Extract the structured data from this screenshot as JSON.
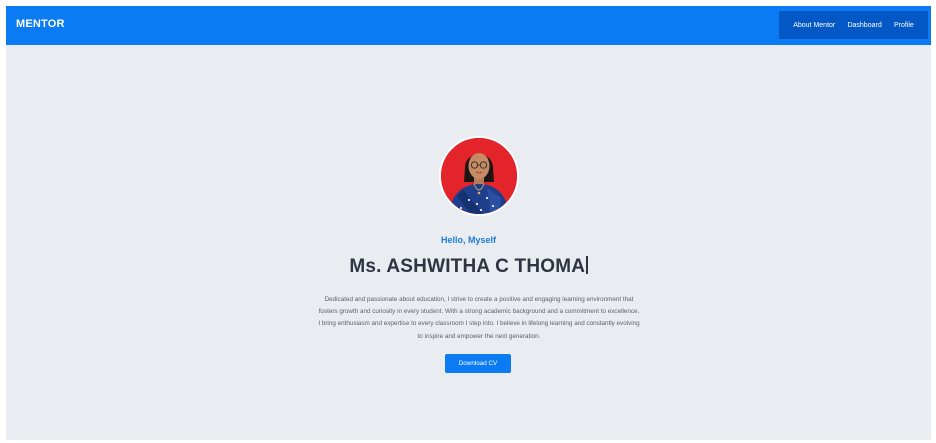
{
  "navbar": {
    "brand": "MENTOR",
    "links": [
      {
        "label": "About Mentor"
      },
      {
        "label": "Dashboard"
      },
      {
        "label": "Profile"
      }
    ]
  },
  "hero": {
    "greeting": "Hello, Myself",
    "name": "Ms. ASHWITHA C THOMA",
    "bio_lines": [
      "Dedicated and passionate about education, I strive to create a positive and engaging learning environment that",
      "fosters growth and curiosity in every student. With a strong academic background and a commitment to excellence,",
      "I bring enthusiasm and expertise to every classroom I step into. I believe in lifelong learning and constantly evolving",
      "to inspire and empower the next generation."
    ],
    "cta_label": "Download CV"
  },
  "colors": {
    "primary": "#0a7bf2",
    "nav_links_bg": "#0458c6",
    "page_bg": "#e9ecf1",
    "avatar_bg": "#e3242a",
    "greeting_text": "#1d7bd8",
    "heading_text": "#2e3540"
  }
}
